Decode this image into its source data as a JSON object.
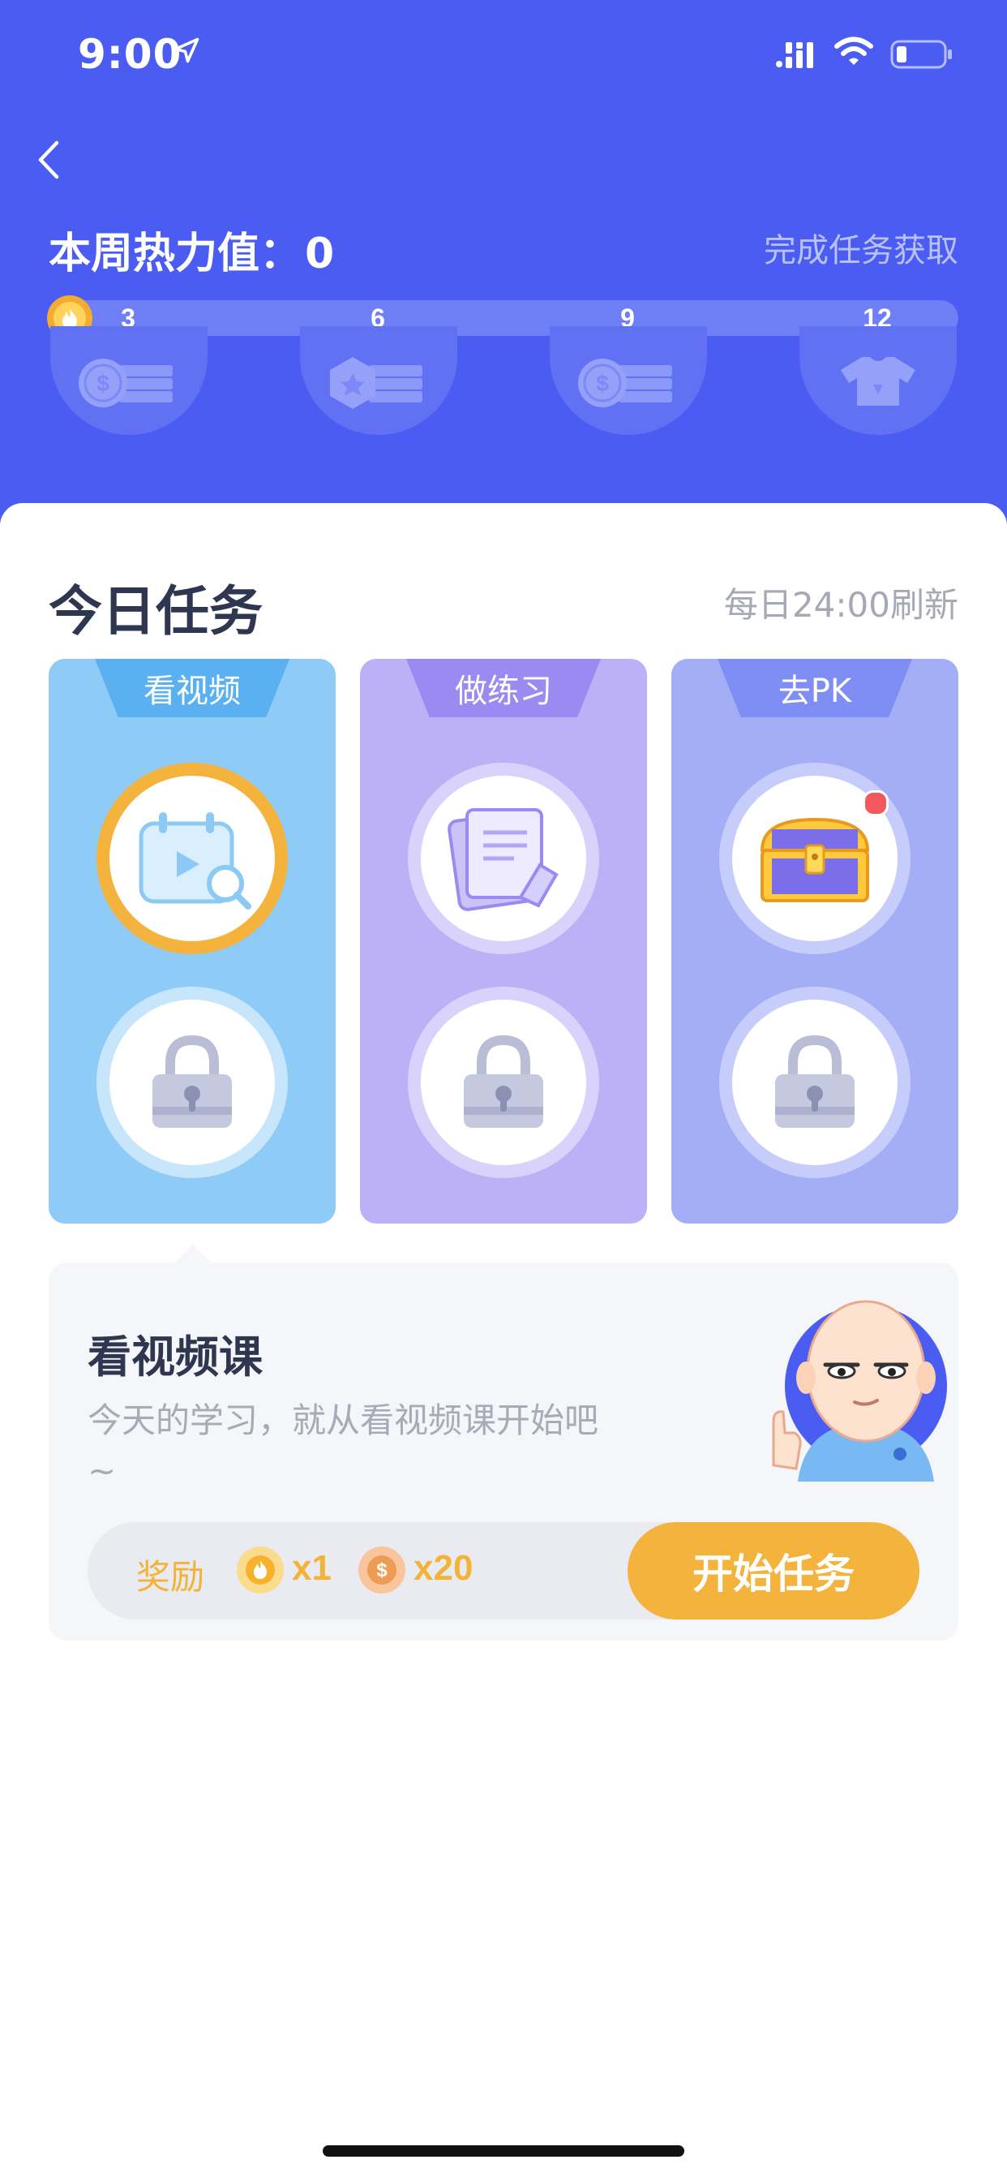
{
  "status_bar": {
    "time": "9:00"
  },
  "header": {
    "title": "本周热力值：",
    "value": "0",
    "hint": "完成任务获取",
    "milestones": [
      {
        "label": "3",
        "reward_icon": "coin-stack-icon"
      },
      {
        "label": "6",
        "reward_icon": "gem-coin-stack-icon"
      },
      {
        "label": "9",
        "reward_icon": "coin-stack-icon"
      },
      {
        "label": "12",
        "reward_icon": "tshirt-icon"
      }
    ],
    "progress": 0
  },
  "today": {
    "title": "今日任务",
    "refresh_note": "每日24:00刷新",
    "tasks": [
      {
        "label": "看视频",
        "icon": "video-calendar-icon",
        "locked_icon": "lock-icon",
        "color": "#8ecbf6",
        "tab_color": "#5ab0f0",
        "selected": true
      },
      {
        "label": "做练习",
        "icon": "exercise-book-icon",
        "locked_icon": "lock-icon",
        "color": "#bcb1f6",
        "tab_color": "#9a8af2",
        "selected": false
      },
      {
        "label": "去PK",
        "icon": "treasure-chest-icon",
        "locked_icon": "lock-icon",
        "color": "#a3aef6",
        "tab_color": "#7f8ef4",
        "selected": false,
        "has_notification": true
      }
    ]
  },
  "detail": {
    "title": "看视频课",
    "description": "今天的学习，就从看视频课开始吧~",
    "reward_label": "奖励",
    "rewards": [
      {
        "icon": "flame-icon",
        "qty": "x1"
      },
      {
        "icon": "dollar-coin-icon",
        "qty": "x20"
      }
    ],
    "start_button": "开始任务"
  }
}
